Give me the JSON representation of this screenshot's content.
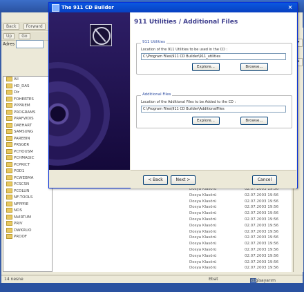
{
  "desktop": {
    "toolbar_buttons": [
      "Back",
      "Forward"
    ],
    "nav_buttons": [
      "Up",
      "Go"
    ],
    "address_label": "Adres",
    "tree_items": [
      "All",
      "HD_DAS",
      "Dir",
      "FOHERTES",
      "PPPRIEM",
      "PROGRAMS",
      "PRAFWDIS",
      "DAEHART",
      "SAMSUNG",
      "PAREBIN",
      "PRSGER",
      "PCHOUSM",
      "PCHMAGIC",
      "PCPRICT",
      "POD1",
      "PCWEBMA",
      "PCSCSN",
      "PCOLUN",
      "NF-TOOLS",
      "NFPPRE",
      "NOS",
      "NVIRTUM",
      "PRIV",
      "DWKRUO",
      "PROOF"
    ],
    "files": [
      {
        "type": "Dosya Klasörü",
        "date": "02.07.2003 19:56"
      },
      {
        "type": "Dosya Klasörü",
        "date": "02.07.2003 19:56"
      },
      {
        "type": "Dosya Klasörü",
        "date": "02.07.2003 19:56"
      },
      {
        "type": "Dosya Klasörü",
        "date": "02.07.2003 19:56"
      },
      {
        "type": "Dosya Klasörü",
        "date": "02.07.2003 19:56"
      },
      {
        "type": "Dosya Klasörü",
        "date": "02.07.2003 19:56"
      },
      {
        "type": "Dosya Klasörü",
        "date": "02.07.2003 19:56"
      },
      {
        "type": "Dosya Klasörü",
        "date": "02.07.2003 19:56"
      },
      {
        "type": "Dosya Klasörü",
        "date": "02.07.2003 19:56"
      },
      {
        "type": "Dosya Klasörü",
        "date": "02.07.2003 19:56"
      },
      {
        "type": "Dosya Klasörü",
        "date": "02.07.2003 19:56"
      },
      {
        "type": "Dosya Klasörü",
        "date": "02.07.2003 19:56"
      },
      {
        "type": "Dosya Klasörü",
        "date": "02.07.2003 19:56"
      },
      {
        "type": "Dosya Klasörü",
        "date": "02.07.2003 19:56"
      }
    ],
    "status_left": "14 nesne",
    "status_mid": "Ebat",
    "status_right": "Bilgisayarım"
  },
  "dialog": {
    "title": "The 911 CD Builder",
    "close_glyph": "×",
    "heading": "911 Utilities / Additional Files",
    "utilities": {
      "legend": "911 Utilities",
      "description": "Location of the 911 Utilities to be used in the CD :",
      "path": "C:\\Program Files\\911 CD Builder\\911_utilities",
      "explore_label": "Explore...",
      "browse_label": "Browse..."
    },
    "additional": {
      "legend": "Additional Files",
      "description": "Location of the Additional Files to be Added to the CD :",
      "path": "C:\\Program Files\\911 CD Builder\\AdditionalFiles",
      "explore_label": "Explore...",
      "browse_label": "Browse..."
    },
    "back_label": "< Back",
    "next_label": "Next >",
    "cancel_label": "Cancel"
  },
  "colors": {
    "accent": "#0a58e0",
    "heading": "#3c3c8c",
    "side_art": "#2e1e66"
  }
}
